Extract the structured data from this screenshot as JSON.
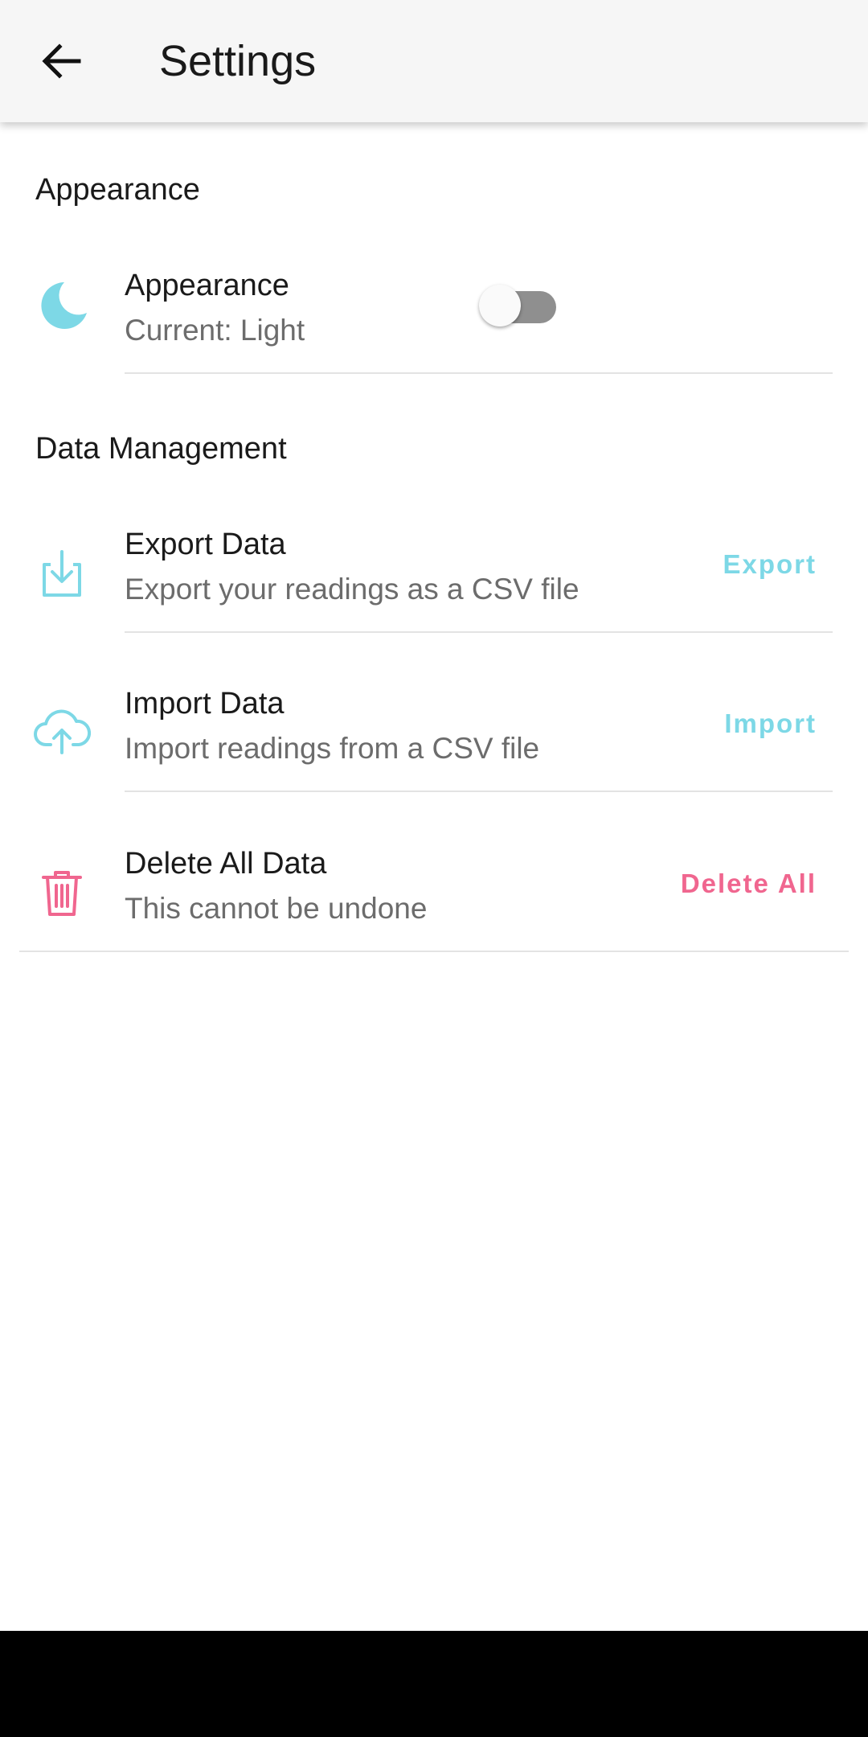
{
  "appbar": {
    "title": "Settings",
    "back_icon": "arrow-left-icon"
  },
  "sections": {
    "appearance": {
      "title": "Appearance"
    },
    "data_management": {
      "title": "Data Management"
    }
  },
  "rows": {
    "appearance": {
      "icon": "moon-icon",
      "title": "Appearance",
      "subtitle": "Current: Light",
      "toggle_on": false
    },
    "export": {
      "icon": "download-icon",
      "title": "Export Data",
      "subtitle": "Export your readings as a CSV file",
      "action": "Export"
    },
    "import": {
      "icon": "cloud-upload-icon",
      "title": "Import Data",
      "subtitle": "Import readings from a CSV file",
      "action": "Import"
    },
    "delete": {
      "icon": "trash-icon",
      "title": "Delete All Data",
      "subtitle": "This cannot be undone",
      "action": "Delete All"
    }
  },
  "colors": {
    "accent": "#7dd8e6",
    "danger": "#f0668f",
    "appbar_bg": "#f6f6f6"
  }
}
